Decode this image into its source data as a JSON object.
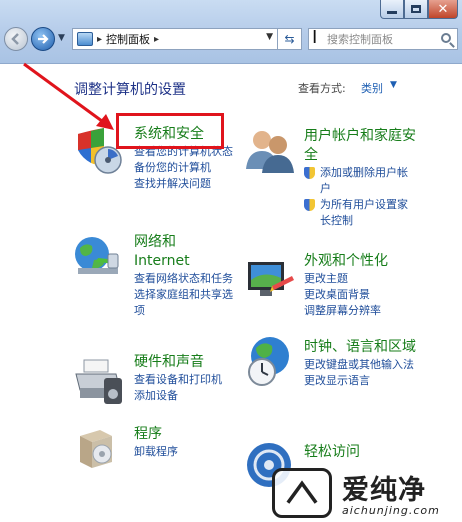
{
  "window": {
    "controls": [
      "minimize-icon",
      "maximize-icon",
      "close-icon"
    ],
    "close_glyph": "✕"
  },
  "toolbar": {
    "address": {
      "crumb": "控制面板",
      "separator": "▸"
    },
    "search": {
      "placeholder": "搜索控制面板"
    }
  },
  "header": {
    "title": "调整计算机的设置",
    "view_by_label": "查看方式:",
    "view_by_value": "类别"
  },
  "categories": [
    {
      "title": "系统和安全",
      "links": [
        "查看您的计算机状态",
        "备份您的计算机",
        "查找并解决问题"
      ]
    },
    {
      "title": "网络和 Internet",
      "links": [
        "查看网络状态和任务",
        "选择家庭组和共享选项"
      ]
    },
    {
      "title": "硬件和声音",
      "links": [
        "查看设备和打印机",
        "添加设备"
      ]
    },
    {
      "title": "程序",
      "links": [
        "卸载程序"
      ]
    },
    {
      "title": "用户帐户和家庭安全",
      "links": [
        "添加或删除用户帐户",
        "为所有用户设置家长控制"
      ]
    },
    {
      "title": "外观和个性化",
      "links": [
        "更改主题",
        "更改桌面背景",
        "调整屏幕分辨率"
      ]
    },
    {
      "title": "时钟、语言和区域",
      "links": [
        "更改键盘或其他输入法",
        "更改显示语言"
      ]
    },
    {
      "title": "轻松访问",
      "links": []
    }
  ],
  "annotation": {
    "color": "#e0141c"
  },
  "watermark": {
    "text": "爱纯净",
    "url": "aichunjing.com"
  },
  "colors": {
    "category": "#177d1a",
    "link": "#1f4d9a",
    "title": "#1e3287"
  }
}
